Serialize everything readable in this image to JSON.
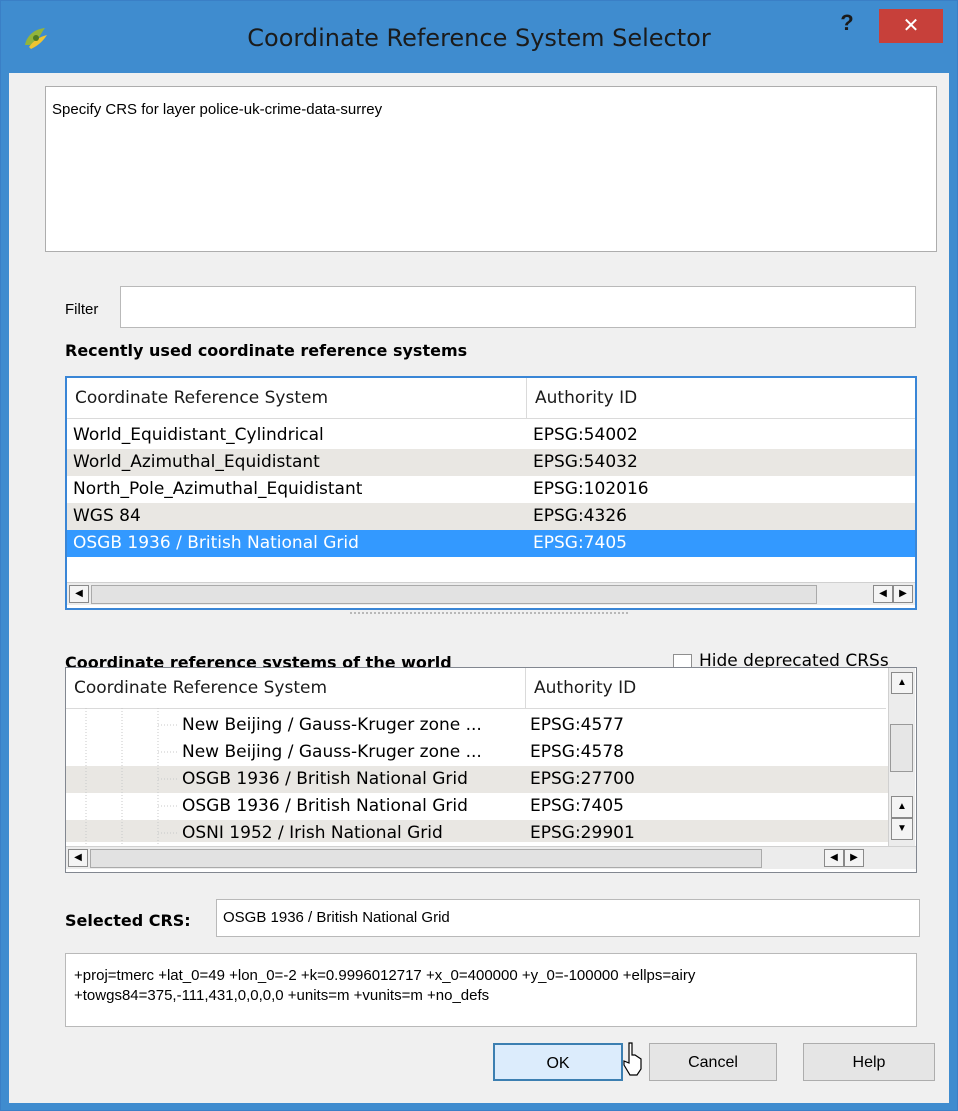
{
  "window": {
    "title": "Coordinate Reference System Selector",
    "help_label": "?",
    "close_label": "✕"
  },
  "message": "Specify CRS for layer police-uk-crime-data-surrey",
  "filter": {
    "label": "Filter",
    "value": ""
  },
  "recent": {
    "label": "Recently used coordinate reference systems",
    "columns": [
      "Coordinate Reference System",
      "Authority ID"
    ],
    "rows": [
      {
        "name": "World_Equidistant_Cylindrical",
        "id": "EPSG:54002"
      },
      {
        "name": "World_Azimuthal_Equidistant",
        "id": "EPSG:54032"
      },
      {
        "name": "North_Pole_Azimuthal_Equidistant",
        "id": "EPSG:102016"
      },
      {
        "name": "WGS 84",
        "id": "EPSG:4326"
      },
      {
        "name": "OSGB 1936 / British National Grid",
        "id": "EPSG:7405"
      }
    ]
  },
  "world": {
    "label": "Coordinate reference systems of the world",
    "hide_deprecated_label": "Hide deprecated CRSs",
    "hide_deprecated_checked": false,
    "columns": [
      "Coordinate Reference System",
      "Authority ID"
    ],
    "rows": [
      {
        "name": "New Beijing / Gauss-Kruger zone ...",
        "id": "EPSG:4577"
      },
      {
        "name": "New Beijing / Gauss-Kruger zone ...",
        "id": "EPSG:4578"
      },
      {
        "name": "OSGB 1936 / British National Grid",
        "id": "EPSG:27700"
      },
      {
        "name": "OSGB 1936 / British National Grid",
        "id": "EPSG:7405"
      },
      {
        "name": "OSNI 1952 / Irish National Grid",
        "id": "EPSG:29901"
      }
    ]
  },
  "selected": {
    "label": "Selected CRS:",
    "value": "OSGB 1936 / British National Grid",
    "proj": "+proj=tmerc +lat_0=49 +lon_0=-2 +k=0.9996012717 +x_0=400000 +y_0=-100000 +ellps=airy +towgs84=375,-111,431,0,0,0,0 +units=m +vunits=m +no_defs"
  },
  "buttons": {
    "ok": "OK",
    "cancel": "Cancel",
    "help": "Help"
  },
  "icons": {
    "app": "qgis-logo-icon",
    "scroll_left": "◀",
    "scroll_right": "▶",
    "scroll_up": "▲",
    "scroll_down": "▼"
  },
  "colors": {
    "titlebar": "#3f8ccf",
    "selection": "#3399ff",
    "close": "#c7403a"
  }
}
